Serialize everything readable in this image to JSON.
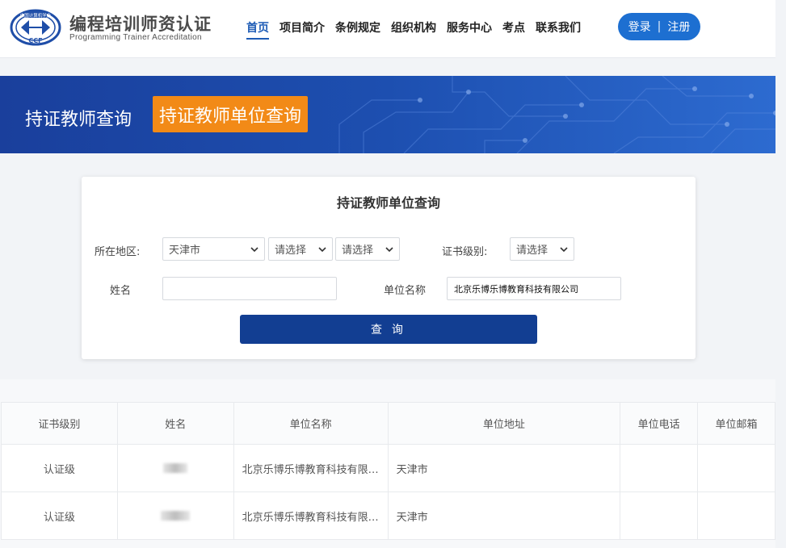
{
  "header": {
    "logo_text": "中国计算机学会",
    "logo_mark": "CCF",
    "brand_cn": "编程培训师资认证",
    "brand_en": "Programming Trainer Accreditation",
    "nav": [
      "首页",
      "项目简介",
      "条例规定",
      "组织机构",
      "服务中心",
      "考点",
      "联系我们"
    ],
    "login": "登录",
    "separator": "|",
    "register": "注册"
  },
  "banner": {
    "tab_teacher": "持证教师查询",
    "tab_org": "持证教师单位查询"
  },
  "search": {
    "title": "持证教师单位查询",
    "region_label": "所在地区:",
    "province": "天津市",
    "city": "请选择",
    "district": "请选择",
    "cert_label": "证书级别:",
    "cert_level": "请选择",
    "name_label": "姓名",
    "name_value": "",
    "org_label": "单位名称",
    "org_value": "北京乐博乐博教育科技有限公司",
    "query_button": "查 询"
  },
  "table": {
    "headers": [
      "证书级别",
      "姓名",
      "单位名称",
      "单位地址",
      "单位电话",
      "单位邮箱"
    ],
    "rows": [
      {
        "level": "认证级",
        "org": "北京乐博乐博教育科技有限公...",
        "address": "天津市",
        "phone": "",
        "email": ""
      },
      {
        "level": "认证级",
        "org": "北京乐博乐博教育科技有限公...",
        "address": "天津市",
        "phone": "",
        "email": ""
      }
    ]
  },
  "colors": {
    "primary": "#1d5bb5",
    "query_button": "#123e92",
    "active_tab": "#f28a17"
  }
}
